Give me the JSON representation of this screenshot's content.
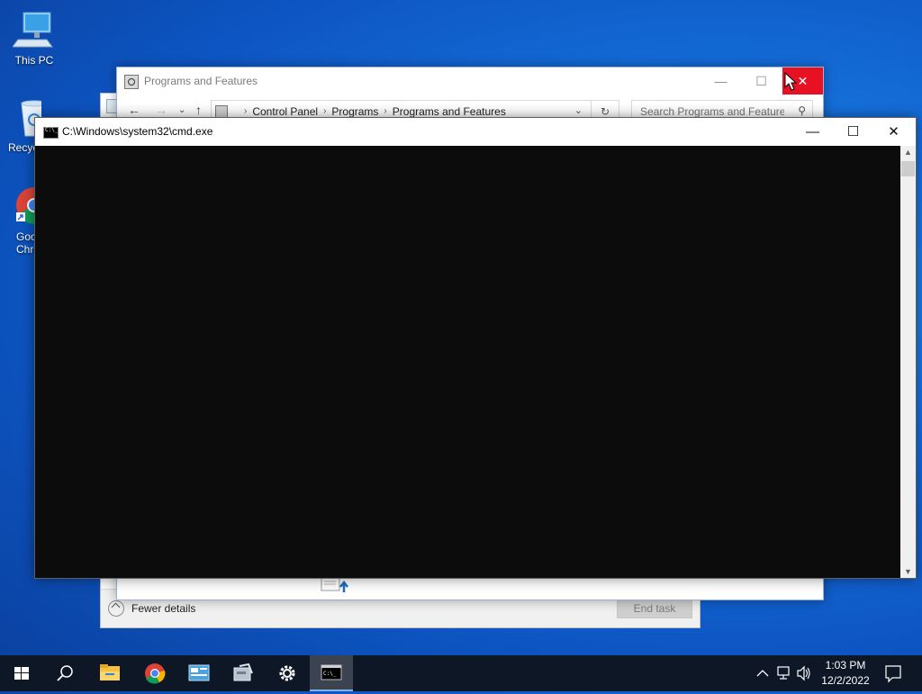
{
  "desktop": {
    "icons": [
      {
        "label": "This PC",
        "icon": "computer-icon"
      },
      {
        "label": "Recyc",
        "icon": "recycle-bin-icon"
      },
      {
        "label": "Goo",
        "label2": "Chro",
        "icon": "google-chrome-icon"
      }
    ]
  },
  "task_manager": {
    "fewer_details": "Fewer details",
    "end_task": "End task"
  },
  "programs_features": {
    "title": "Programs and Features",
    "breadcrumb": [
      "Control Panel",
      "Programs",
      "Programs and Features"
    ],
    "search_placeholder": "Search Programs and Features"
  },
  "cmd": {
    "title": "C:\\Windows\\system32\\cmd.exe",
    "console_bg": "#0c0c0c"
  },
  "taskbar": {
    "items": [
      "start-icon",
      "search-icon",
      "file-explorer-icon",
      "google-chrome-icon",
      "control-panel-icon",
      "programs-icon",
      "settings-icon",
      "cmd-icon"
    ],
    "active": "cmd-icon",
    "time": "1:03 PM",
    "date": "12/2/2022"
  },
  "colors": {
    "close_red": "#e81123",
    "taskbar": "#0e1726",
    "desktop_blue": "#1672dd"
  }
}
